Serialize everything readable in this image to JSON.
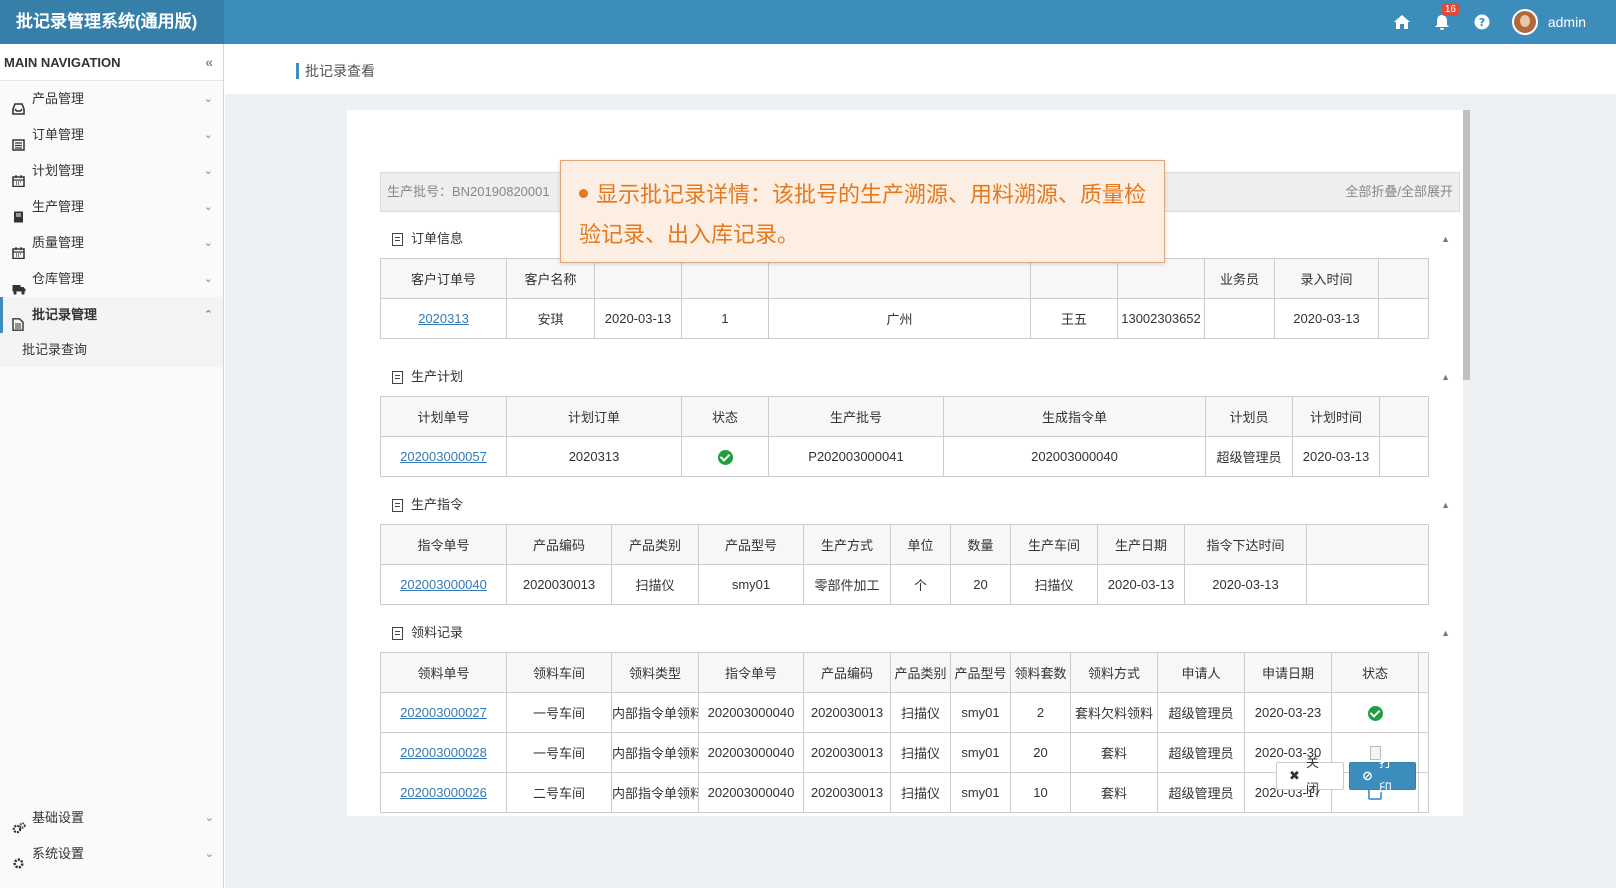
{
  "app": {
    "title": "批记录管理系统(通用版)"
  },
  "header": {
    "notification_count": "16",
    "user_name": "admin"
  },
  "sidebar": {
    "header": "MAIN NAVIGATION",
    "collapse": "«",
    "items": [
      {
        "label": "产品管理",
        "icon": "inbox-icon"
      },
      {
        "label": "订单管理",
        "icon": "list-icon"
      },
      {
        "label": "计划管理",
        "icon": "calendar-icon"
      },
      {
        "label": "生产管理",
        "icon": "book-icon"
      },
      {
        "label": "质量管理",
        "icon": "calendar-icon"
      },
      {
        "label": "仓库管理",
        "icon": "truck-icon"
      },
      {
        "label": "批记录管理",
        "icon": "file-icon"
      }
    ],
    "sub_items": [
      {
        "label": "批记录查询"
      }
    ],
    "bottom_items": [
      {
        "label": "基础设置",
        "icon": "gears-icon"
      },
      {
        "label": "系统设置",
        "icon": "gear-icon"
      }
    ]
  },
  "page": {
    "title": "批记录查看"
  },
  "batch": {
    "label": "生产批号：BN20190820001",
    "toggle": "全部折叠/全部展开"
  },
  "tooltip": {
    "text": "显示批记录详情：该批号的生产溯源、用料溯源、质量检验记录、出入库记录。"
  },
  "order_info": {
    "title": "订单信息",
    "headers": [
      "客户订单号",
      "客户名称",
      "",
      "",
      "",
      "",
      "",
      "业务员",
      "录入时间",
      ""
    ],
    "row": [
      "2020313",
      "安琪",
      "2020-03-13",
      "1",
      "广州",
      "王五",
      "13002303652",
      "",
      "2020-03-13",
      ""
    ]
  },
  "production_plan": {
    "title": "生产计划",
    "headers": [
      "计划单号",
      "计划订单",
      "状态",
      "生产批号",
      "生成指令单",
      "计划员",
      "计划时间",
      ""
    ],
    "row": [
      "202003000057",
      "2020313",
      "",
      "P202003000041",
      "202003000040",
      "超级管理员",
      "2020-03-13",
      ""
    ]
  },
  "production_order": {
    "title": "生产指令",
    "headers": [
      "指令单号",
      "产品编码",
      "产品类别",
      "产品型号",
      "生产方式",
      "单位",
      "数量",
      "生产车间",
      "生产日期",
      "指令下达时间",
      ""
    ],
    "row": [
      "202003000040",
      "2020030013",
      "扫描仪",
      "smy01",
      "零部件加工",
      "个",
      "20",
      "扫描仪",
      "2020-03-13",
      "2020-03-13",
      ""
    ]
  },
  "material_records": {
    "title": "领料记录",
    "headers": [
      "领料单号",
      "领料车间",
      "领料类型",
      "指令单号",
      "产品编码",
      "产品类别",
      "产品型号",
      "领料套数",
      "领料方式",
      "申请人",
      "申请日期",
      "状态",
      ""
    ],
    "rows": [
      {
        "cells": [
          "202003000027",
          "一号车间",
          "内部指令单领料",
          "202003000040",
          "2020030013",
          "扫描仪",
          "smy01",
          "2",
          "套料欠料领料",
          "超级管理员",
          "2020-03-23"
        ],
        "status_icon": "check-circle-icon"
      },
      {
        "cells": [
          "202003000028",
          "一号车间",
          "内部指令单领料",
          "202003000040",
          "2020030013",
          "扫描仪",
          "smy01",
          "20",
          "套料",
          "超级管理员",
          "2020-03-30"
        ],
        "status_icon": "file-icon"
      },
      {
        "cells": [
          "202003000026",
          "二号车间",
          "内部指令单领料",
          "202003000040",
          "2020030013",
          "扫描仪",
          "smy01",
          "10",
          "套料",
          "超级管理员",
          "2020-03-17"
        ],
        "status_icon": "share-icon"
      }
    ]
  },
  "buttons": {
    "close": "关闭",
    "print": "打印"
  },
  "colors": {
    "header": "#3c8dbc",
    "brand": "#367fa9",
    "tooltip_text": "#e37a1f",
    "tooltip_bg": "#fdeee3",
    "ok": "#1e9e3e"
  }
}
